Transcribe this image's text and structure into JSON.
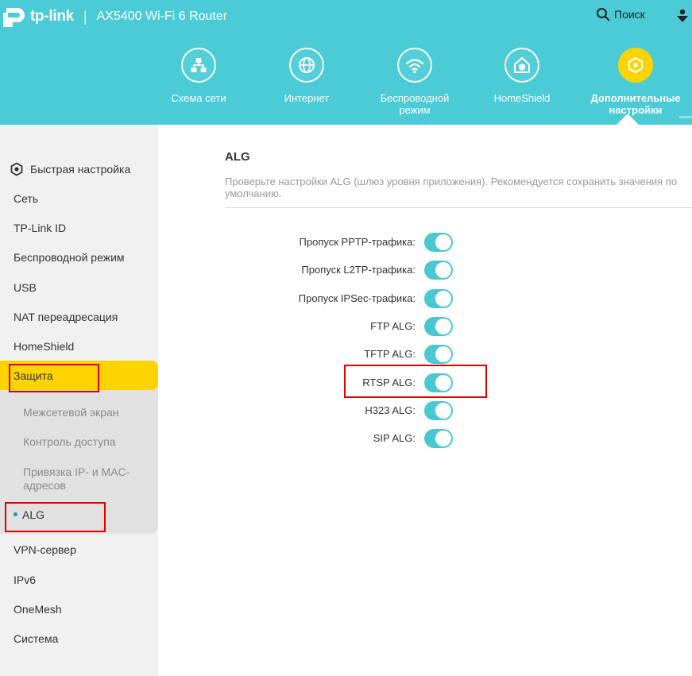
{
  "header": {
    "brand": "tp-link",
    "separator": "|",
    "model": "AX5400 Wi-Fi 6 Router",
    "search_label": "Поиск",
    "nav": [
      {
        "label": "Схема сети",
        "icon": "network-map-icon"
      },
      {
        "label": "Интернет",
        "icon": "globe-icon"
      },
      {
        "label": "Беспроводной режим",
        "icon": "wifi-icon"
      },
      {
        "label": "HomeShield",
        "icon": "home-shield-icon"
      },
      {
        "label": "Дополнительные настройки",
        "icon": "advanced-gear-icon",
        "active": true
      }
    ]
  },
  "sidebar": {
    "quick_setup": "Быстрая настройка",
    "items": [
      "Сеть",
      "TP-Link ID",
      "Беспроводной режим",
      "USB",
      "NAT переадресация",
      "HomeShield",
      "Защита"
    ],
    "security_sub": [
      "Межсетевой экран",
      "Контроль доступа",
      "Привязка IP- и MAC-адресов",
      "ALG"
    ],
    "items_after": [
      "VPN-сервер",
      "IPv6",
      "OneMesh",
      "Система"
    ]
  },
  "main": {
    "title": "ALG",
    "description_line1": "Проверьте настройки ALG (шлюз уровня приложения). Рекомендуется сохранить значения по",
    "description_line2": "умолчанию.",
    "settings": [
      {
        "label": "Пропуск PPTP-трафика:",
        "enabled": true
      },
      {
        "label": "Пропуск L2TP-трафика:",
        "enabled": true
      },
      {
        "label": "Пропуск IPSec-трафика:",
        "enabled": true
      },
      {
        "label": "FTP ALG:",
        "enabled": true
      },
      {
        "label": "TFTP ALG:",
        "enabled": true
      },
      {
        "label": "RTSP ALG:",
        "enabled": true
      },
      {
        "label": "H323 ALG:",
        "enabled": true
      },
      {
        "label": "SIP ALG:",
        "enabled": true
      }
    ]
  },
  "colors": {
    "header_bg": "#4acbd6",
    "accent_yellow": "#fdd400",
    "toggle_on": "#4ac7d1",
    "highlight_red": "#e00000"
  }
}
